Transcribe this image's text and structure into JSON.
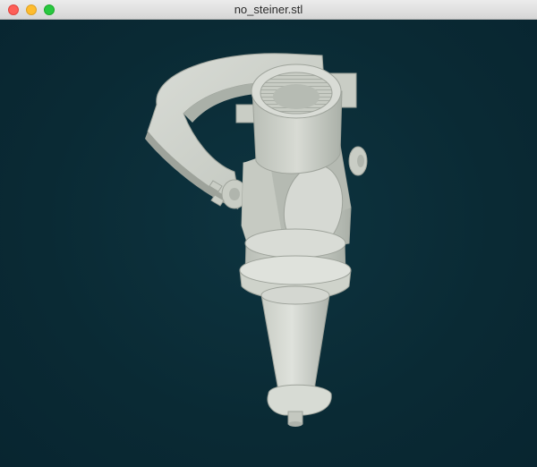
{
  "window": {
    "title": "no_steiner.stl"
  },
  "titlebar": {
    "buttons": [
      {
        "name": "close",
        "color": "#fe5f57"
      },
      {
        "name": "minimize",
        "color": "#febc2e"
      },
      {
        "name": "zoom",
        "color": "#28c840"
      }
    ]
  },
  "viewport": {
    "background_color": "#0c2a33",
    "model_color": "#d7dbd4",
    "model_shadow_color": "#aeb3ac"
  }
}
